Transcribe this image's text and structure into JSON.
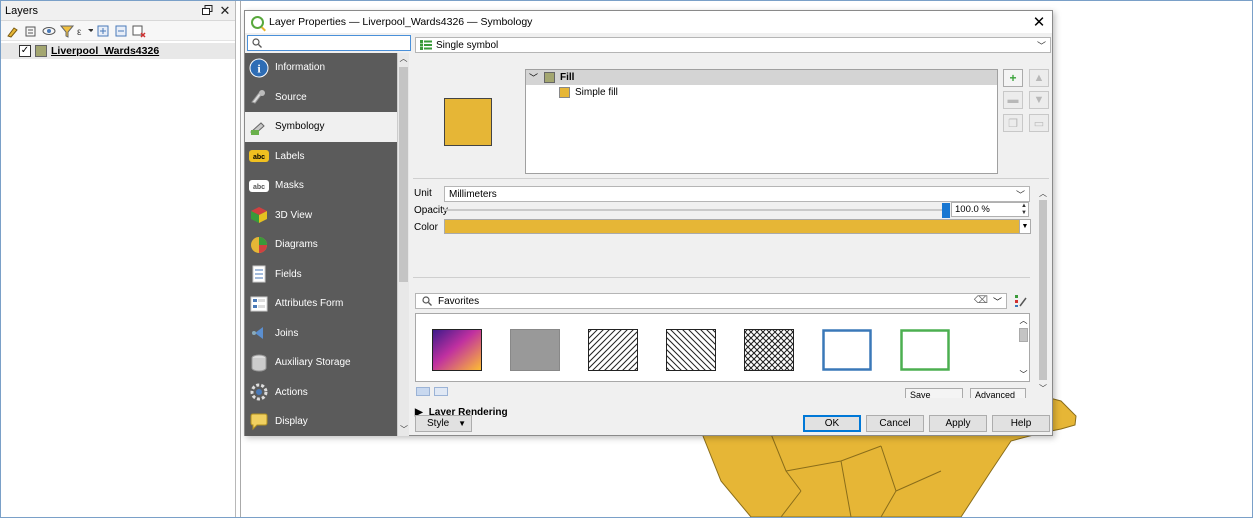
{
  "layers_panel": {
    "title": "Layers",
    "float_icon": "float-window-icon",
    "close_icon": "close-icon",
    "toolbar_icons": [
      "style-manager-icon",
      "add-group-icon",
      "manage-visibility-icon",
      "filter-legend-icon",
      "filter-by-expression-icon",
      "expand-all-icon",
      "collapse-all-icon",
      "remove-layer-icon"
    ],
    "layer": {
      "name": "Liverpool_Wards4326",
      "checked": true,
      "swatch_color": "#a3a670"
    }
  },
  "dialog": {
    "title": "Layer Properties — Liverpool_Wards4326 — Symbology",
    "search_value": "",
    "nav_items": [
      {
        "label": "Information",
        "icon": "information-icon",
        "active": false
      },
      {
        "label": "Source",
        "icon": "source-icon",
        "active": false
      },
      {
        "label": "Symbology",
        "icon": "symbology-icon",
        "active": true
      },
      {
        "label": "Labels",
        "icon": "labels-icon",
        "active": false
      },
      {
        "label": "Masks",
        "icon": "masks-icon",
        "active": false
      },
      {
        "label": "3D View",
        "icon": "3d-view-icon",
        "active": false
      },
      {
        "label": "Diagrams",
        "icon": "diagrams-icon",
        "active": false
      },
      {
        "label": "Fields",
        "icon": "fields-icon",
        "active": false
      },
      {
        "label": "Attributes Form",
        "icon": "attributes-form-icon",
        "active": false
      },
      {
        "label": "Joins",
        "icon": "joins-icon",
        "active": false
      },
      {
        "label": "Auxiliary Storage",
        "icon": "auxiliary-storage-icon",
        "active": false
      },
      {
        "label": "Actions",
        "icon": "actions-icon",
        "active": false
      },
      {
        "label": "Display",
        "icon": "display-icon",
        "active": false
      }
    ],
    "renderer": "Single symbol",
    "symbol_tree": {
      "root": "Fill",
      "child": "Simple fill"
    },
    "fill_color": "#e6b636",
    "unit_label": "Unit",
    "unit_value": "Millimeters",
    "opacity_label": "Opacity",
    "opacity_value": "100.0 %",
    "opacity_fraction": 1.0,
    "color_label": "Color",
    "favorites_search": "Favorites",
    "symbols": [
      {
        "name": "gradient-fill",
        "kind": "gradient"
      },
      {
        "name": "gray-fill",
        "kind": "solid"
      },
      {
        "name": "diagonal-hatch-fill",
        "kind": "hatch-fwd"
      },
      {
        "name": "back-diagonal-hatch-fill",
        "kind": "hatch-back"
      },
      {
        "name": "cross-hatch-fill",
        "kind": "cross"
      },
      {
        "name": "blue-outline-fill",
        "kind": "outline",
        "color": "#3a78b8"
      },
      {
        "name": "green-outline-fill",
        "kind": "outline",
        "color": "#4caf50"
      }
    ],
    "save_symbol": "Save Symbol...",
    "advanced": "Advanced",
    "layer_rendering": "Layer Rendering",
    "style_button": "Style",
    "buttons": {
      "ok": "OK",
      "cancel": "Cancel",
      "apply": "Apply",
      "help": "Help"
    }
  },
  "map": {
    "polygon_fill": "#e6b636",
    "polygon_stroke": "#8a6d1a"
  }
}
